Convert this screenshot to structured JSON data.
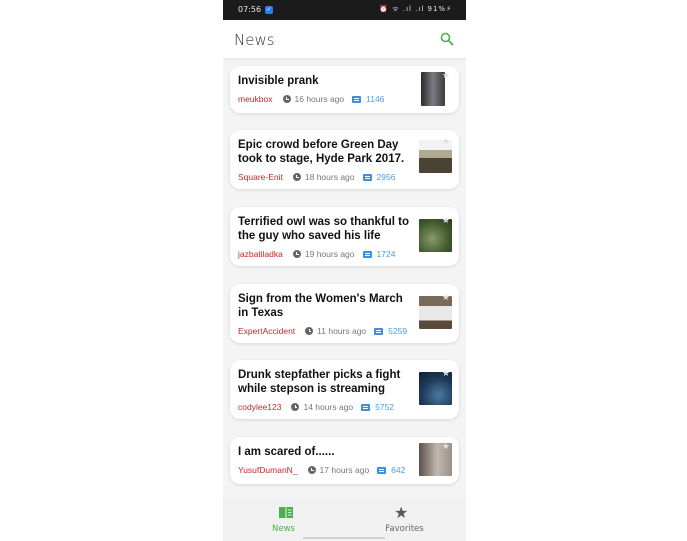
{
  "status_bar": {
    "time": "07:56",
    "indicators": "⏰ ᯤ .ıl .ıl 91%⚡"
  },
  "app_bar": {
    "title": "News",
    "search_icon": "search-icon",
    "accent_color": "#4caf50"
  },
  "articles": [
    {
      "title": "Invisible prank",
      "author": "meukbox",
      "age": "16 hours ago",
      "comments": "1146",
      "thumb_color": "#3a3a3a"
    },
    {
      "title": "Epic crowd before Green Day took to stage, Hyde Park 2017.",
      "author": "Square-Enit",
      "age": "18 hours ago",
      "comments": "2956",
      "thumb_color": "#6b6450"
    },
    {
      "title": "Terrified owl was so thankful to the guy who saved his life",
      "author": "jazbatiladka",
      "age": "19 hours ago",
      "comments": "1724",
      "thumb_color": "#3f5a2e"
    },
    {
      "title": "Sign from the Women's March in Texas",
      "author": "ExpertAccident",
      "age": "11 hours ago",
      "comments": "5259",
      "thumb_color": "#7a6a58"
    },
    {
      "title": "Drunk stepfather picks a fight while stepson is streaming",
      "author": "codylee123",
      "age": "14 hours ago",
      "comments": "5752",
      "thumb_color": "#1e3a5a"
    },
    {
      "title": "I am scared of......",
      "author": "YusufDumanN_",
      "age": "17 hours ago",
      "comments": "642",
      "thumb_color": "#8a7a70"
    }
  ],
  "bottom_nav": {
    "tabs": [
      {
        "label": "News",
        "icon": "book-icon",
        "active": true
      },
      {
        "label": "Favorites",
        "icon": "star-icon",
        "active": false
      }
    ]
  },
  "colors": {
    "author": "#c62828",
    "comment_count": "#4a9ee6",
    "active_tab": "#4caf50"
  }
}
